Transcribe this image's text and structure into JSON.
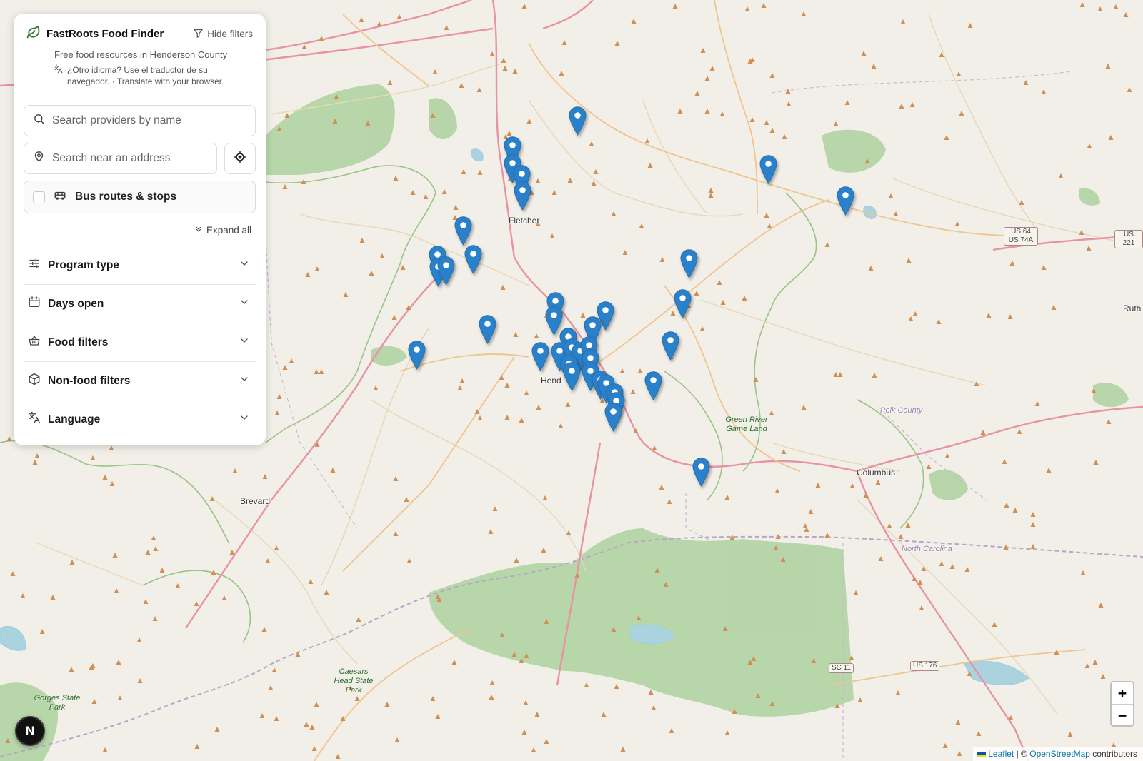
{
  "app": {
    "title": "FastRoots Food Finder",
    "subtitle": "Free food resources in Henderson County",
    "translate_note": "¿Otro idioma? Use el traductor de su navegador. · Translate with your browser.",
    "hide_filters_label": "Hide filters",
    "brand_color": "#2e7d32"
  },
  "search": {
    "provider_placeholder": "Search providers by name",
    "address_placeholder": "Search near an address"
  },
  "bus_toggle": {
    "label": "Bus routes & stops",
    "checked": false
  },
  "expand_all_label": "Expand all",
  "filters": [
    {
      "label": "Program type",
      "icon": "sliders-icon"
    },
    {
      "label": "Days open",
      "icon": "calendar-icon"
    },
    {
      "label": "Food filters",
      "icon": "basket-icon"
    },
    {
      "label": "Non-food filters",
      "icon": "package-icon"
    },
    {
      "label": "Language",
      "icon": "translate-icon"
    }
  ],
  "map": {
    "marker_color": "#2a81cb",
    "places": [
      {
        "name": "Fletcher"
      },
      {
        "name": "Hend"
      },
      {
        "name": "Brevard"
      },
      {
        "name": "Columbus"
      },
      {
        "name": "Ruth"
      },
      {
        "name": "North Carolina"
      },
      {
        "name": "Polk County"
      }
    ],
    "parks": [
      {
        "name": "Green River Game Land"
      },
      {
        "name": "Caesars Head State Park"
      },
      {
        "name": "Gorges State Park"
      }
    ],
    "shields": [
      "US 64 US 74A",
      "US 221",
      "SC 11",
      "US 176"
    ],
    "zoom_in": "+",
    "zoom_out": "−"
  },
  "attribution": {
    "leaflet": "Leaflet",
    "separator": "| ©",
    "osm": "OpenStreetMap",
    "suffix": "contributors"
  },
  "user_badge": "N"
}
